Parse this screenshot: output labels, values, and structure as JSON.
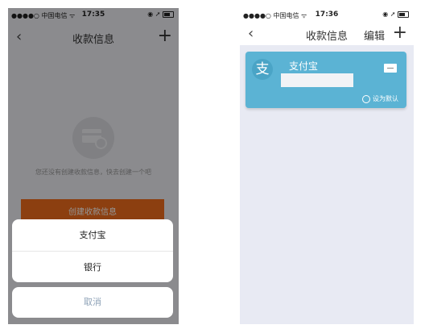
{
  "left": {
    "status": {
      "carrier": "●●●●○ 中国电信 ᯤ",
      "time": "17:35",
      "icons": "◉ ➚"
    },
    "nav": {
      "back": "‹",
      "title": "收款信息",
      "plus": "+"
    },
    "empty_text": "您还没有创建收款信息，快去创建一个吧",
    "create_button": "创建收款信息",
    "sheet_options": [
      "支付宝",
      "银行"
    ],
    "cancel": "取消"
  },
  "right": {
    "status": {
      "carrier": "●●●●○ 中国电信 ᯤ",
      "time": "17:36",
      "icons": "◉ ➚"
    },
    "nav": {
      "back": "‹",
      "title": "收款信息",
      "edit": "编辑",
      "plus": "+"
    },
    "card": {
      "logo": "支",
      "name": "支付宝",
      "default_label": "设为默认"
    }
  }
}
